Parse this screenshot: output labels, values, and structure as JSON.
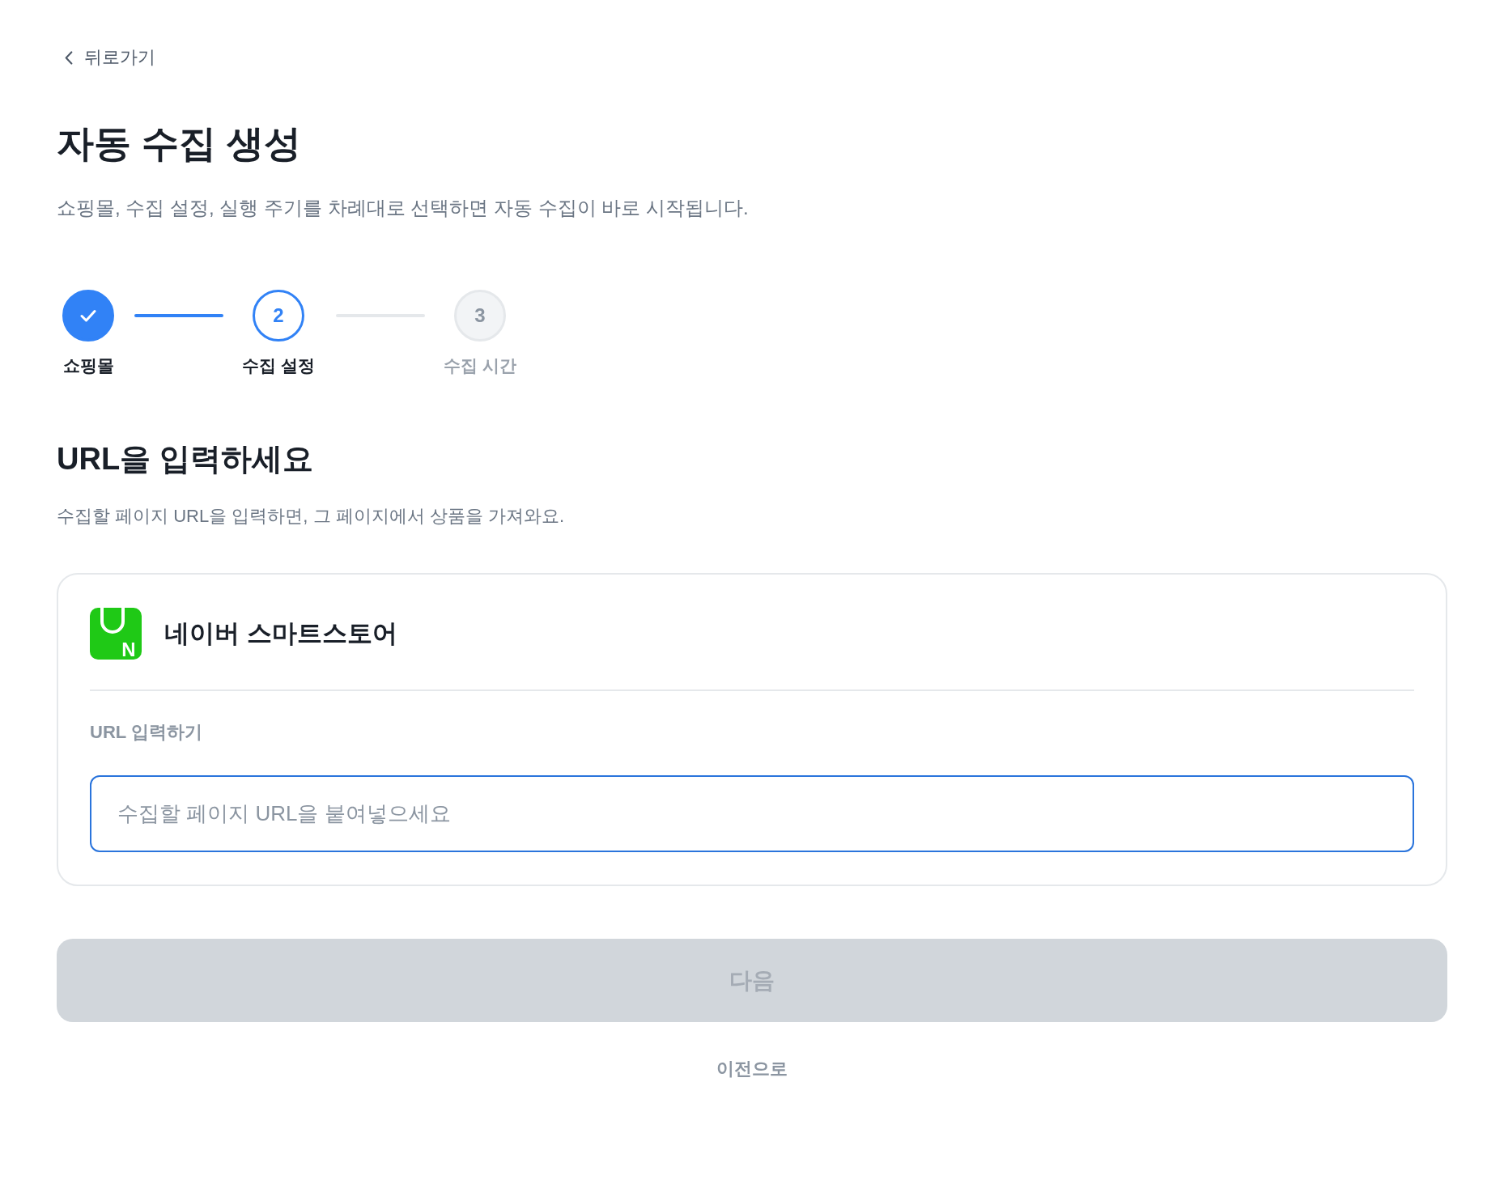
{
  "back_link": {
    "label": "뒤로가기"
  },
  "header": {
    "title": "자동 수집 생성",
    "description": "쇼핑몰, 수집 설정, 실행 주기를 차례대로 선택하면 자동 수집이 바로 시작됩니다."
  },
  "stepper": {
    "steps": [
      {
        "kind": "done",
        "label": "쇼핑몰"
      },
      {
        "kind": "current",
        "number": "2",
        "label": "수집 설정"
      },
      {
        "kind": "upcoming",
        "number": "3",
        "label": "수집 시간"
      }
    ]
  },
  "section": {
    "title": "URL을 입력하세요",
    "description": "수집할 페이지 URL을 입력하면, 그 페이지에서 상품을 가져와요."
  },
  "card": {
    "store": {
      "name": "네이버 스마트스토어",
      "logo_letter": "N"
    },
    "url_field": {
      "label": "URL 입력하기",
      "placeholder": "수집할 페이지 URL을 붙여넣으세요",
      "focused": true
    }
  },
  "next_button": {
    "label": "다음",
    "disabled": true
  },
  "prev_link": {
    "label": "이전으로"
  }
}
